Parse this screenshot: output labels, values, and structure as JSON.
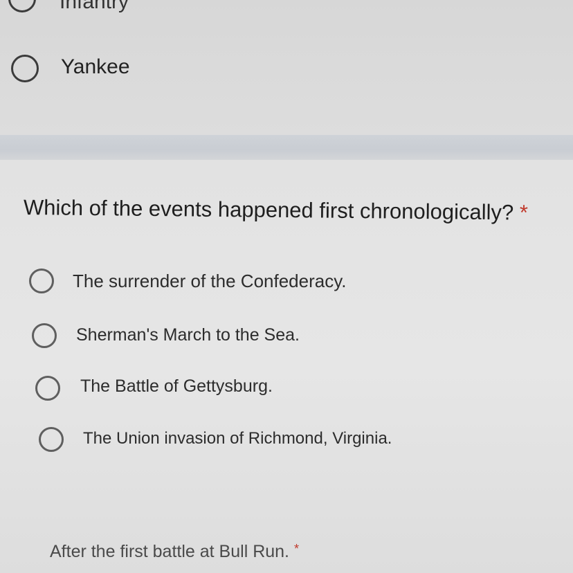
{
  "previous_question": {
    "options": [
      {
        "label": "Infantry"
      },
      {
        "label": "Yankee"
      }
    ]
  },
  "question": {
    "title": "Which of the events happened first chronologically?",
    "required_marker": "*",
    "options": [
      {
        "label": "The surrender of the Confederacy."
      },
      {
        "label": "Sherman's March to the Sea."
      },
      {
        "label": "The Battle of Gettysburg."
      },
      {
        "label": "The Union invasion of Richmond, Virginia."
      }
    ]
  },
  "next_question": {
    "title": "After the first battle at Bull Run.",
    "required_marker": "*"
  }
}
